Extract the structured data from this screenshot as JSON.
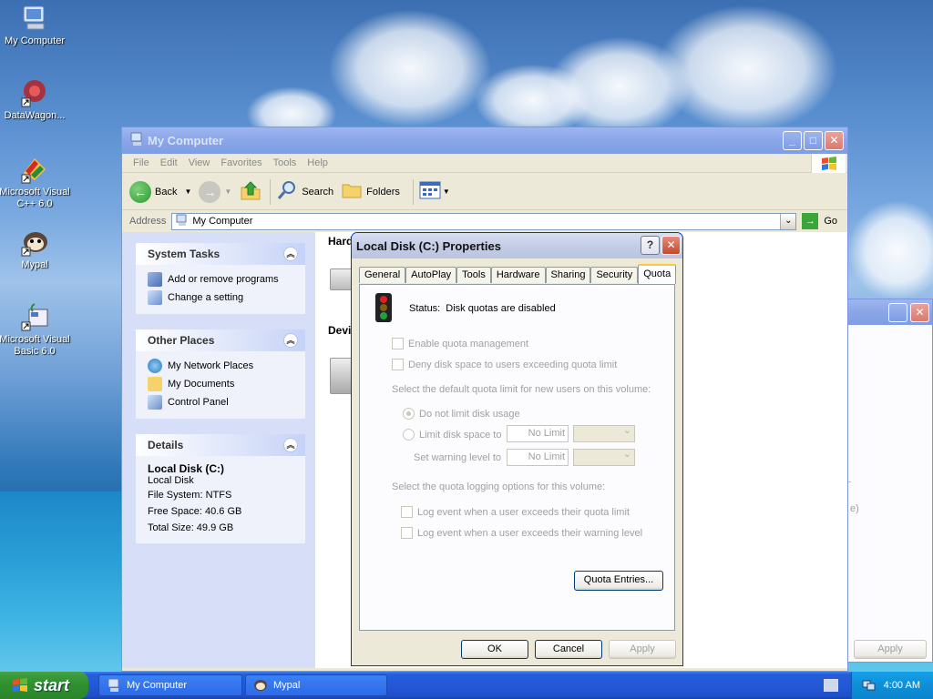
{
  "desktop": {
    "icons": [
      {
        "label": "My Computer"
      },
      {
        "label": "DataWagon..."
      },
      {
        "label": "Microsoft Visual C++ 6.0"
      },
      {
        "label": "Mypal"
      },
      {
        "label": "Microsoft Visual Basic 6.0"
      }
    ]
  },
  "explorer": {
    "title": "My Computer",
    "menu": [
      "File",
      "Edit",
      "View",
      "Favorites",
      "Tools",
      "Help"
    ],
    "toolbar": {
      "back": "Back",
      "search": "Search",
      "folders": "Folders"
    },
    "address": {
      "label": "Address",
      "value": "My Computer",
      "go": "Go"
    },
    "system_tasks": {
      "title": "System Tasks",
      "items": [
        "Add or remove programs",
        "Change a setting"
      ]
    },
    "other_places": {
      "title": "Other Places",
      "items": [
        "My Network Places",
        "My Documents",
        "Control Panel"
      ]
    },
    "details": {
      "title": "Details",
      "name": "Local Disk (C:)",
      "type": "Local Disk",
      "fs": "File System: NTFS",
      "free": "Free Space: 40.6 GB",
      "total": "Total Size: 49.9 GB"
    },
    "content": {
      "group1": "Hard",
      "group2": "Devi"
    }
  },
  "background_window": {
    "apply": "Apply",
    "fragment": "e)"
  },
  "dialog": {
    "title": "Local Disk (C:) Properties",
    "help": "?",
    "tabs": [
      "General",
      "AutoPlay",
      "Tools",
      "Hardware",
      "Sharing",
      "Security",
      "Quota"
    ],
    "status_label": "Status:",
    "status_text": "Disk quotas are disabled",
    "enable_quota": "Enable quota management",
    "deny_space": "Deny disk space to users exceeding quota limit",
    "default_limit_header": "Select the default quota limit for new users on this volume:",
    "no_limit": "Do not limit disk usage",
    "limit_to": "Limit disk space to",
    "warning_level": "Set warning level to",
    "limit_value": "No Limit",
    "warning_value": "No Limit",
    "logging_header": "Select the quota logging options for this volume:",
    "log_quota": "Log event when a user exceeds their quota limit",
    "log_warning": "Log event when a user exceeds their warning level",
    "quota_entries": "Quota Entries...",
    "ok": "OK",
    "cancel": "Cancel",
    "apply": "Apply"
  },
  "taskbar": {
    "start": "start",
    "tasks": [
      "My Computer",
      "Mypal"
    ],
    "clock": "4:00 AM"
  }
}
